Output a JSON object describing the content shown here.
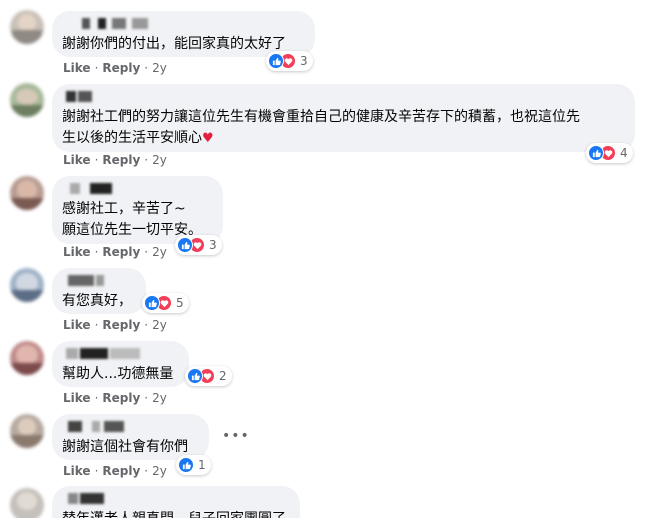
{
  "actions": {
    "like": "Like",
    "reply": "Reply",
    "separator": "·"
  },
  "comments": [
    {
      "text": "謝謝你們的付出，能回家真的太好了",
      "heart": false,
      "time": "2y",
      "reactions": [
        "like",
        "love"
      ],
      "count": "3"
    },
    {
      "text": "謝謝社工們的努力讓這位先生有機會重拾自己的健康及辛苦存下的積蓄，也祝這位先\n生以後的生活平安順心",
      "heart": true,
      "time": "2y",
      "reactions": [
        "like",
        "love"
      ],
      "count": "4"
    },
    {
      "text": "感謝社工，辛苦了~\n願這位先生一切平安。",
      "heart": false,
      "time": "2y",
      "reactions": [
        "like",
        "love"
      ],
      "count": "3"
    },
    {
      "text": "有您真好，",
      "heart": false,
      "time": "2y",
      "reactions": [
        "like",
        "love"
      ],
      "count": "5"
    },
    {
      "text": "幫助人...功德無量",
      "heart": false,
      "time": "2y",
      "reactions": [
        "like",
        "love"
      ],
      "count": "2"
    },
    {
      "text": "謝謝這個社會有你們",
      "heart": false,
      "time": "2y",
      "reactions": [
        "like"
      ],
      "count": "1",
      "more": "•••"
    },
    {
      "text": "替年邁老人親真門，兒子回家團圓了",
      "heart": false,
      "time": "",
      "reactions": [],
      "count": ""
    }
  ],
  "colors": {
    "bubble": "#f0f2f5",
    "like": "#1877f2",
    "love": "#f33e58",
    "heart": "#e41e3f",
    "meta": "#65676b"
  },
  "icons": {
    "like": "thumbs-up-icon",
    "love": "heart-icon",
    "inline_heart": "red-heart-emoji"
  }
}
